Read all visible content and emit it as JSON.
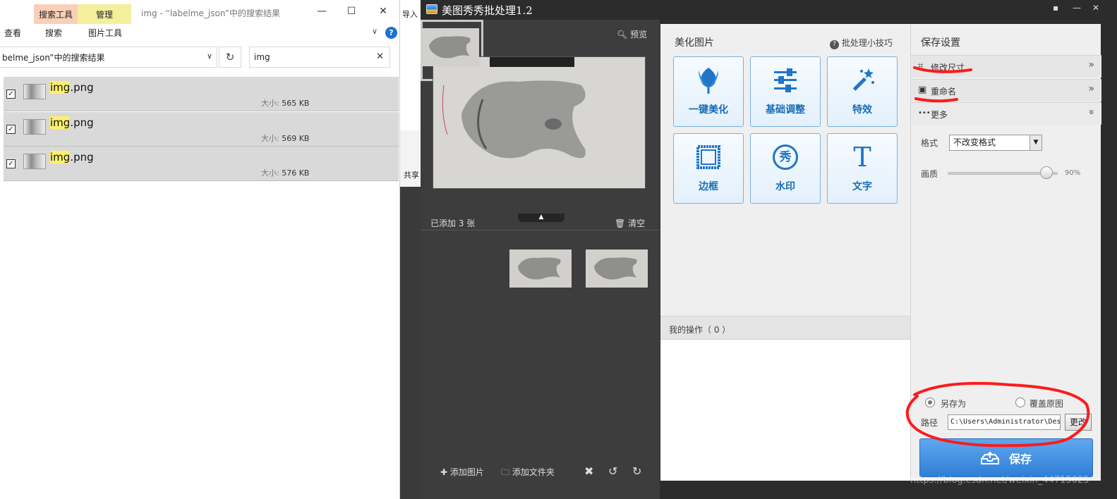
{
  "explorer": {
    "context_tabs": [
      "搜索工具",
      "管理"
    ],
    "ribbon_tabs": [
      "查看",
      "搜索",
      "图片工具"
    ],
    "window_title": "img - “labelme_json”中的搜索结果",
    "address": "belme_json”中的搜索结果",
    "search_value": "img",
    "peek_share": "共享",
    "peek_import": "导入",
    "files": [
      {
        "name_hl": "img",
        "name_rest": ".png",
        "size_label": "大小:",
        "size": "565 KB"
      },
      {
        "name_hl": "img",
        "name_rest": ".png",
        "size_label": "大小:",
        "size": "569 KB"
      },
      {
        "name_hl": "img",
        "name_rest": ".png",
        "size_label": "大小:",
        "size": "576 KB"
      }
    ],
    "colors": {
      "search_tab": "#f9cfb7",
      "manage_tab": "#f3ef9c",
      "highlight": "#fff06c"
    }
  },
  "meitu": {
    "title": "美图秀秀批处理1.2",
    "preview_label": "预览",
    "added_label": "已添加 3 张",
    "clear_label": "清空",
    "bottom": {
      "add_image": "添加图片",
      "add_folder": "添加文件夹"
    },
    "beautify": {
      "title": "美化图片",
      "tips": "批处理小技巧",
      "tools": [
        {
          "label": "一键美化",
          "icon": "tulip-icon"
        },
        {
          "label": "基础调整",
          "icon": "sliders-icon"
        },
        {
          "label": "特效",
          "icon": "magic-wand-icon"
        },
        {
          "label": "边框",
          "icon": "frame-icon"
        },
        {
          "label": "水印",
          "icon": "watermark-icon",
          "glyph": "秀"
        },
        {
          "label": "文字",
          "icon": "text-icon",
          "glyph": "T"
        }
      ],
      "ops_label": "我的操作（ 0 ）"
    },
    "save_settings": {
      "title": "保存设置",
      "sections": [
        "修改尺寸",
        "重命名",
        "更多"
      ],
      "format_label": "格式",
      "format_value": "不改变格式",
      "quality_label": "画质",
      "quality_value": "90%",
      "quality_fraction": 0.9,
      "save_as": "另存为",
      "overwrite": "覆盖原图",
      "path_label": "路径",
      "path_value": "C:\\Users\\Administrator\\Des",
      "change_btn": "更改",
      "save_btn": "保存"
    },
    "colors": {
      "accent": "#2f7ed6",
      "tile_text": "#1a6db5",
      "annotation": "#ff0000"
    }
  },
  "watermark": "https://blog.csdn.net/weixin_44715025"
}
